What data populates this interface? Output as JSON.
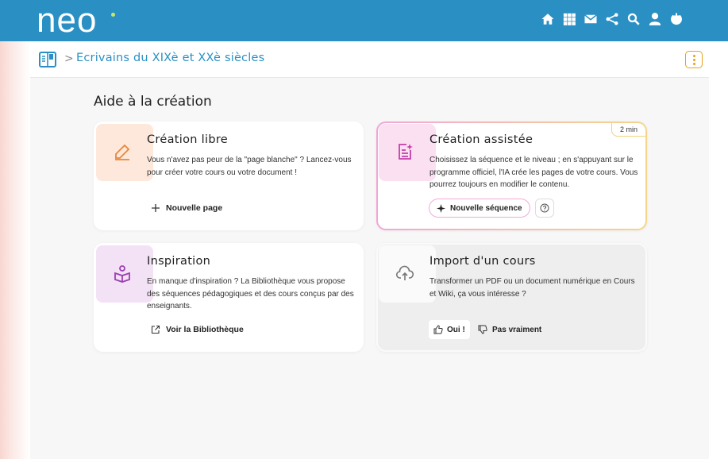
{
  "header": {
    "logo_text": "neo",
    "bar_color": "#2a90c4",
    "icons": [
      "home-icon",
      "apps-grid-icon",
      "mail-icon",
      "share-icon",
      "search-icon",
      "user-icon",
      "power-icon"
    ]
  },
  "breadcrumb": {
    "separator": ">",
    "title": "Ecrivains du XIXè et XXè siècles",
    "menu_icon": "kebab-menu-icon",
    "accent_color": "#e6a21a"
  },
  "page": {
    "section_title": "Aide à la création"
  },
  "cards": {
    "libre": {
      "title": "Création libre",
      "description": "Vous n'avez pas peur de la \"page blanche\" ? Lancez-vous pour créer votre cours ou votre document !",
      "action_label": "Nouvelle page",
      "icon": "pencil-icon",
      "color": "#e8873a"
    },
    "assistee": {
      "title": "Création assistée",
      "badge": "2 min",
      "description": "Choisissez la séquence et le niveau ; en s'appuyant sur le programme officiel, l'IA crée les pages de votre cours. Vous pourrez toujours en modifier le contenu.",
      "action_label": "Nouvelle séquence",
      "icon": "ai-document-icon",
      "color": "#c23fa8"
    },
    "inspiration": {
      "title": "Inspiration",
      "description": "En manque d'inspiration ? La Bibliothèque vous propose des séquences pédagogiques et des cours conçus par des enseignants.",
      "action_label": "Voir la Bibliothèque",
      "icon": "library-icon",
      "color": "#9b3fb0"
    },
    "import": {
      "title": "Import d'un cours",
      "description": "Transformer un PDF ou un document numérique en Cours et Wiki, ça vous intéresse ?",
      "yes_label": "Oui !",
      "no_label": "Pas vraiment",
      "icon": "cloud-upload-icon"
    }
  }
}
